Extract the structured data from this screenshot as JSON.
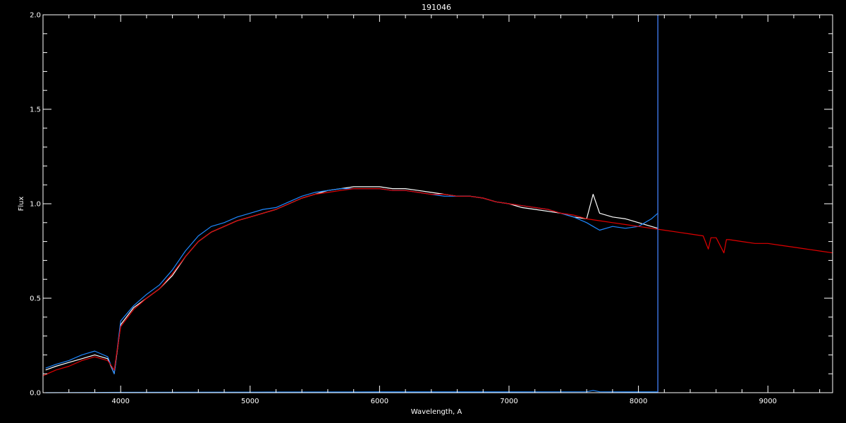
{
  "chart_data": {
    "type": "line",
    "title": "191046",
    "xlabel": "Wavelength, A",
    "ylabel": "Flux",
    "xlim": [
      3400,
      9500
    ],
    "ylim": [
      0.0,
      2.0
    ],
    "xticks": [
      4000,
      5000,
      6000,
      7000,
      8000,
      9000
    ],
    "xtick_labels": [
      "4000",
      "5000",
      "6000",
      "7000",
      "8000",
      "9000"
    ],
    "yticks": [
      0.0,
      0.5,
      1.0,
      1.5,
      2.0
    ],
    "ytick_labels": [
      "0.0",
      "0.5",
      "1.0",
      "1.5",
      "2.0"
    ],
    "grid": false,
    "vertical_marker": {
      "x": 8150,
      "color": "#3a6fd8"
    },
    "series": [
      {
        "color": "#ffffff",
        "x": [
          3420,
          3500,
          3600,
          3700,
          3800,
          3900,
          3950,
          4000,
          4100,
          4200,
          4300,
          4400,
          4500,
          4600,
          4700,
          4800,
          4900,
          5000,
          5100,
          5200,
          5300,
          5400,
          5500,
          5600,
          5700,
          5800,
          5900,
          6000,
          6100,
          6200,
          6300,
          6400,
          6500,
          6600,
          6700,
          6800,
          6900,
          7000,
          7100,
          7200,
          7300,
          7400,
          7500,
          7600,
          7650,
          7700,
          7800,
          7900,
          8000,
          8100,
          8150
        ],
        "y": [
          0.12,
          0.14,
          0.16,
          0.18,
          0.2,
          0.18,
          0.1,
          0.36,
          0.45,
          0.5,
          0.55,
          0.62,
          0.72,
          0.8,
          0.85,
          0.88,
          0.91,
          0.93,
          0.95,
          0.97,
          1.0,
          1.03,
          1.05,
          1.07,
          1.08,
          1.09,
          1.09,
          1.09,
          1.08,
          1.08,
          1.07,
          1.06,
          1.05,
          1.04,
          1.04,
          1.03,
          1.01,
          1.0,
          0.98,
          0.97,
          0.96,
          0.95,
          0.93,
          0.92,
          1.05,
          0.95,
          0.93,
          0.92,
          0.9,
          0.88,
          0.87
        ]
      },
      {
        "color": "#1e88ff",
        "x": [
          3420,
          3500,
          3600,
          3700,
          3800,
          3900,
          3950,
          4000,
          4100,
          4200,
          4300,
          4400,
          4500,
          4600,
          4700,
          4800,
          4900,
          5000,
          5100,
          5200,
          5300,
          5400,
          5500,
          5600,
          5700,
          5800,
          5900,
          6000,
          6100,
          6200,
          6300,
          6400,
          6500,
          6600,
          6700,
          6800,
          6900,
          7000,
          7100,
          7200,
          7300,
          7400,
          7500,
          7600,
          7650,
          7700,
          7800,
          7900,
          8000,
          8100,
          8150
        ],
        "y": [
          0.13,
          0.15,
          0.17,
          0.2,
          0.22,
          0.19,
          0.1,
          0.38,
          0.46,
          0.52,
          0.57,
          0.65,
          0.75,
          0.83,
          0.88,
          0.9,
          0.93,
          0.95,
          0.97,
          0.98,
          1.01,
          1.04,
          1.06,
          1.07,
          1.08,
          1.08,
          1.08,
          1.08,
          1.07,
          1.07,
          1.06,
          1.05,
          1.04,
          1.04,
          1.04,
          1.03,
          1.01,
          1.0,
          0.99,
          0.98,
          0.97,
          0.95,
          0.93,
          0.9,
          0.88,
          0.86,
          0.88,
          0.87,
          0.88,
          0.92,
          0.95
        ]
      },
      {
        "color": "#e00000",
        "x": [
          3400,
          3500,
          3600,
          3700,
          3800,
          3900,
          3950,
          4000,
          4100,
          4200,
          4300,
          4400,
          4500,
          4600,
          4700,
          4800,
          4900,
          5000,
          5100,
          5200,
          5300,
          5400,
          5500,
          5600,
          5700,
          5800,
          5900,
          6000,
          6100,
          6200,
          6300,
          6400,
          6500,
          6600,
          6700,
          6800,
          6900,
          7000,
          7100,
          7200,
          7300,
          7400,
          7500,
          7600,
          7700,
          7800,
          7900,
          8000,
          8100,
          8200,
          8300,
          8400,
          8500,
          8540,
          8560,
          8600,
          8660,
          8680,
          8700,
          8800,
          8900,
          9000,
          9100,
          9200,
          9300,
          9400,
          9500
        ],
        "y": [
          0.09,
          0.12,
          0.14,
          0.17,
          0.19,
          0.17,
          0.12,
          0.35,
          0.44,
          0.5,
          0.55,
          0.63,
          0.72,
          0.8,
          0.85,
          0.88,
          0.91,
          0.93,
          0.95,
          0.97,
          1.0,
          1.03,
          1.05,
          1.06,
          1.07,
          1.08,
          1.08,
          1.08,
          1.07,
          1.07,
          1.06,
          1.05,
          1.05,
          1.04,
          1.04,
          1.03,
          1.01,
          1.0,
          0.99,
          0.98,
          0.97,
          0.95,
          0.94,
          0.92,
          0.91,
          0.9,
          0.89,
          0.88,
          0.87,
          0.86,
          0.85,
          0.84,
          0.83,
          0.76,
          0.82,
          0.82,
          0.74,
          0.81,
          0.81,
          0.8,
          0.79,
          0.79,
          0.78,
          0.77,
          0.76,
          0.75,
          0.74
        ]
      },
      {
        "color": "#1e88ff",
        "x": [
          3420,
          4000,
          5000,
          6000,
          7000,
          7600,
          7650,
          7700,
          8000,
          8150
        ],
        "y": [
          0.0,
          0.002,
          0.003,
          0.004,
          0.004,
          0.005,
          0.012,
          0.005,
          0.004,
          0.004
        ]
      }
    ]
  }
}
